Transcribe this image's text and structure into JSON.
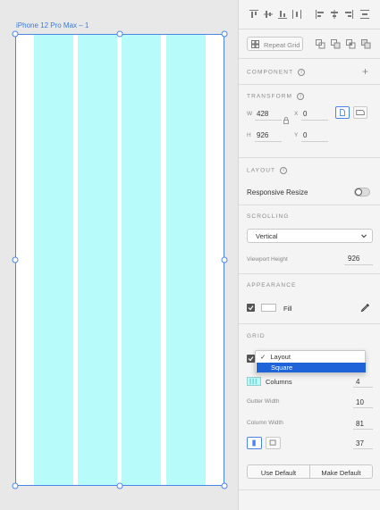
{
  "canvas": {
    "artboard_title": "iPhone 12 Pro Max – 1"
  },
  "panel": {
    "repeat_grid_label": "Repeat Grid",
    "component": {
      "title": "COMPONENT",
      "add_symbol": "+"
    },
    "transform": {
      "title": "TRANSFORM",
      "w_label": "W",
      "w_value": "428",
      "x_label": "X",
      "x_value": "0",
      "h_label": "H",
      "h_value": "926",
      "y_label": "Y",
      "y_value": "0"
    },
    "layout": {
      "title": "LAYOUT",
      "responsive_resize_label": "Responsive Resize",
      "responsive_resize_on": false
    },
    "scrolling": {
      "title": "SCROLLING",
      "mode_value": "Vertical",
      "viewport_height_label": "Viewport Height",
      "viewport_height_value": "926"
    },
    "appearance": {
      "title": "APPEARANCE",
      "fill_label": "Fill",
      "fill_checked": true,
      "fill_color": "#ffffff"
    },
    "grid": {
      "title": "GRID",
      "enabled": true,
      "dropdown_options": [
        "Layout",
        "Square"
      ],
      "dropdown_checked": "Layout",
      "dropdown_highlighted": "Square",
      "columns_label": "Columns",
      "columns_value": "4",
      "gutter_width_label": "Gutter Width",
      "gutter_width_value": "10",
      "column_width_label": "Column Width",
      "column_width_value": "81",
      "margin_value": "37",
      "use_default_label": "Use Default",
      "make_default_label": "Make Default",
      "grid_color": "#b8fbfb"
    }
  },
  "colors": {
    "accent": "#4a86e8",
    "selection": "#1e63d8",
    "grid_column": "#b8fbfb"
  }
}
